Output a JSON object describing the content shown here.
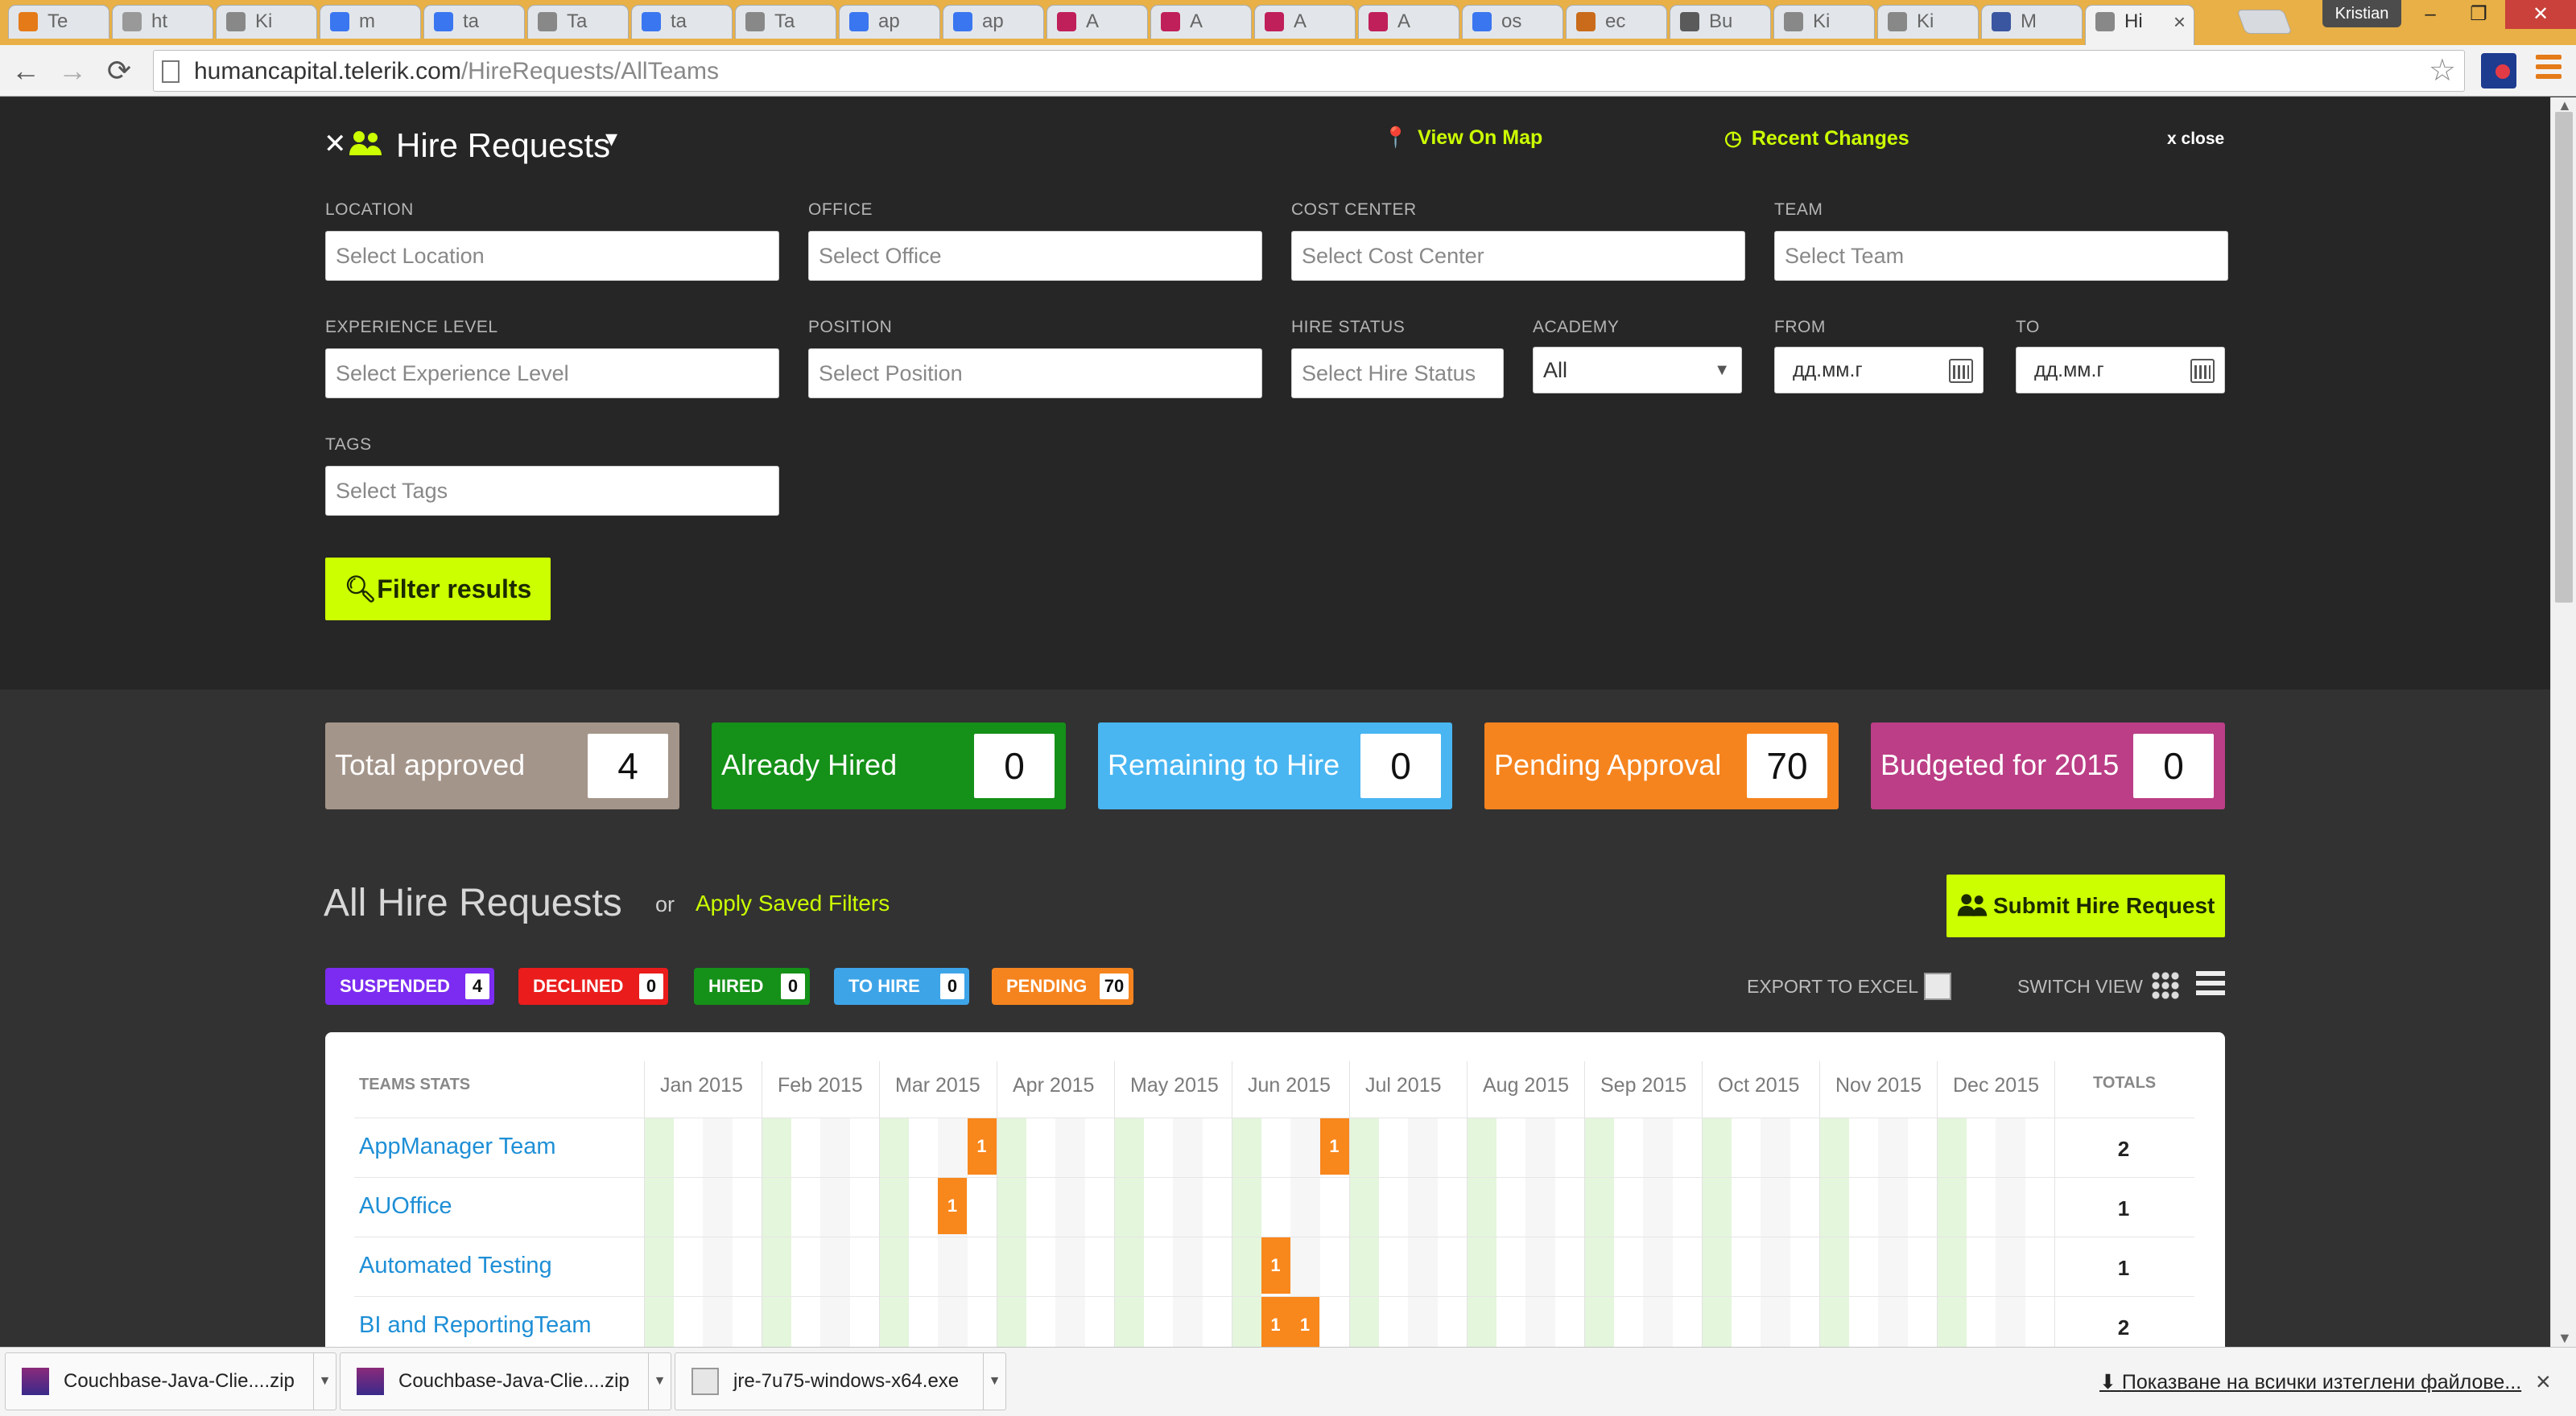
{
  "browser": {
    "tabs": [
      "Te",
      "ht",
      "Ki",
      "m",
      "ta",
      "Ta",
      "ta",
      "Ta",
      "ap",
      "ap",
      "A",
      "A",
      "A",
      "A",
      "os",
      "ec",
      "Bu",
      "Ki",
      "Ki",
      "M",
      "Hi"
    ],
    "tab_close": "×",
    "user_badge": "Kristian",
    "window": {
      "minimize": "–",
      "maximize": "❐",
      "close": "✕"
    },
    "url_domain": "humancapital.telerik.com",
    "url_path": "/HireRequests/AllTeams",
    "nav": {
      "back": "←",
      "forward": "→",
      "reload": "⟳",
      "star": "☆"
    }
  },
  "header": {
    "title": "Hire Requests",
    "title_caret": "▾",
    "view_on_map": "View On Map",
    "recent_changes": "Recent Changes",
    "close": "x close"
  },
  "filters": {
    "location": {
      "label": "LOCATION",
      "placeholder": "Select Location"
    },
    "office": {
      "label": "OFFICE",
      "placeholder": "Select Office"
    },
    "cost_center": {
      "label": "COST CENTER",
      "placeholder": "Select Cost Center"
    },
    "team": {
      "label": "TEAM",
      "placeholder": "Select Team"
    },
    "experience": {
      "label": "EXPERIENCE LEVEL",
      "placeholder": "Select Experience Level"
    },
    "position": {
      "label": "POSITION",
      "placeholder": "Select Position"
    },
    "hire_status": {
      "label": "HIRE STATUS",
      "placeholder": "Select Hire Status"
    },
    "academy": {
      "label": "ACADEMY",
      "value": "All"
    },
    "from": {
      "label": "FROM",
      "value": "дд.мм.г"
    },
    "to": {
      "label": "TO",
      "value": "дд.мм.г"
    },
    "tags": {
      "label": "TAGS",
      "placeholder": "Select Tags"
    },
    "button": "Filter results"
  },
  "stats": [
    {
      "label": "Total approved",
      "value": "4",
      "color": "#a4958a"
    },
    {
      "label": "Already Hired",
      "value": "0",
      "color": "#159018"
    },
    {
      "label": "Remaining to Hire",
      "value": "0",
      "color": "#49b6f1"
    },
    {
      "label": "Pending Approval",
      "value": "70",
      "color": "#f5841f"
    },
    {
      "label": "Budgeted for 2015",
      "value": "0",
      "color": "#bb3e86"
    }
  ],
  "section": {
    "title": "All Hire Requests",
    "or": "or",
    "saved_filters": "Apply Saved Filters",
    "submit": "Submit Hire Request"
  },
  "badges": [
    {
      "label": "SUSPENDED",
      "count": "4",
      "color": "#7b2cf0"
    },
    {
      "label": "DECLINED",
      "count": "0",
      "color": "#ea1c1c"
    },
    {
      "label": "HIRED",
      "count": "0",
      "color": "#159018"
    },
    {
      "label": "TO HIRE",
      "count": "0",
      "color": "#3ea4e8"
    },
    {
      "label": "PENDING",
      "count": "70",
      "color": "#f5841f"
    }
  ],
  "tools": {
    "export": "EXPORT TO EXCEL",
    "switch": "SWITCH VIEW"
  },
  "table": {
    "teams_header": "TEAMS STATS",
    "totals_header": "TOTALS",
    "months": [
      "Jan 2015",
      "Feb 2015",
      "Mar 2015",
      "Apr 2015",
      "May 2015",
      "Jun 2015",
      "Jul 2015",
      "Aug 2015",
      "Sep 2015",
      "Oct 2015",
      "Nov 2015",
      "Dec 2015"
    ],
    "rows": [
      {
        "team": "AppManager Team",
        "total": "2",
        "entries": [
          {
            "month": "Mar 2015",
            "week": 3,
            "value": "1"
          },
          {
            "month": "Jun 2015",
            "week": 3,
            "value": "1"
          }
        ]
      },
      {
        "team": "AUOffice",
        "total": "1",
        "entries": [
          {
            "month": "Mar 2015",
            "week": 2,
            "value": "1"
          }
        ]
      },
      {
        "team": "Automated Testing",
        "total": "1",
        "entries": [
          {
            "month": "Jun 2015",
            "week": 1,
            "value": "1"
          }
        ]
      },
      {
        "team": "BI and ReportingTeam",
        "total": "2",
        "entries": [
          {
            "month": "Jun 2015",
            "week": 1,
            "value": "1"
          },
          {
            "month": "Jun 2015",
            "week": 2,
            "value": "1"
          }
        ]
      }
    ]
  },
  "downloads": {
    "items": [
      "Couchbase-Java-Clie....zip",
      "Couchbase-Java-Clie....zip",
      "jre-7u75-windows-x64.exe"
    ],
    "show_all": "Показване на всички изтеглени файлове...",
    "close": "×"
  }
}
